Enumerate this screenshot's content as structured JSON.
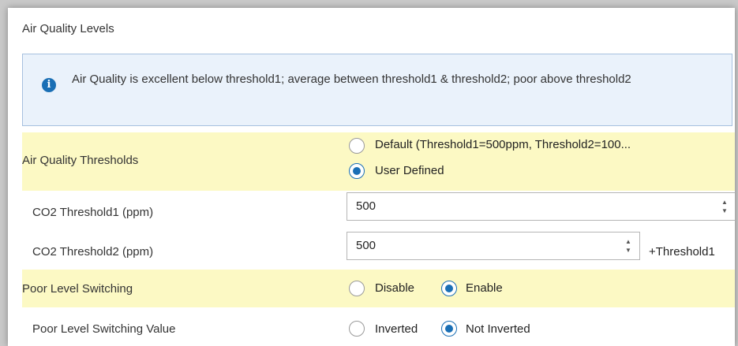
{
  "section": {
    "title": "Air Quality Levels"
  },
  "info": {
    "icon": "info-icon",
    "text": "Air Quality is excellent below threshold1; average between threshold1 & threshold2; poor above threshold2"
  },
  "thresholds": {
    "label": "Air Quality Thresholds",
    "options": [
      {
        "label": "Default (Threshold1=500ppm, Threshold2=100...",
        "checked": false
      },
      {
        "label": "User Defined",
        "checked": true
      }
    ]
  },
  "co2_threshold1": {
    "label": "CO2 Threshold1 (ppm)",
    "value": "500"
  },
  "co2_threshold2": {
    "label": "CO2 Threshold2 (ppm)",
    "value": "500",
    "suffix": "+Threshold1"
  },
  "poor_switching": {
    "label": "Poor Level Switching",
    "options": [
      {
        "label": "Disable",
        "checked": false
      },
      {
        "label": "Enable",
        "checked": true
      }
    ]
  },
  "poor_switching_value": {
    "label": "Poor Level Switching Value",
    "options": [
      {
        "label": "Inverted",
        "checked": false
      },
      {
        "label": "Not Inverted",
        "checked": true
      }
    ]
  },
  "colors": {
    "highlight": "#fcf9c4",
    "info_background": "#eaf2fb",
    "accent": "#1a6fb5"
  }
}
